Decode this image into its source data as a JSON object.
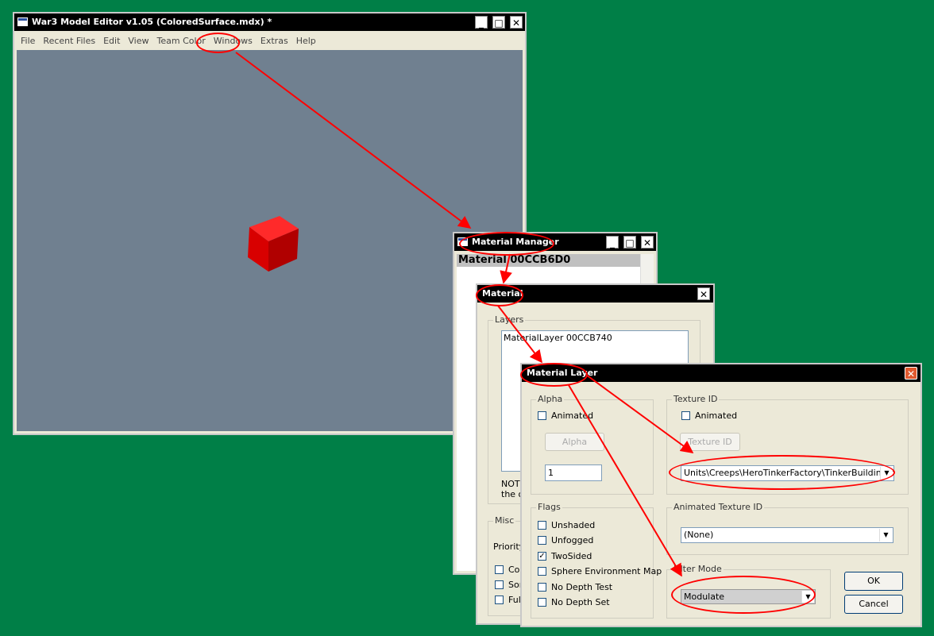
{
  "main_window": {
    "title": "War3 Model Editor v1.05 (ColoredSurface.mdx) *",
    "menu": [
      "File",
      "Recent Files",
      "Edit",
      "View",
      "Team Color",
      "Windows",
      "Extras",
      "Help"
    ]
  },
  "material_manager": {
    "title": "Material Manager",
    "selected_item": "Material 00CCB6D0"
  },
  "material": {
    "title": "Material",
    "layers_label": "Layers",
    "layer_item": "MaterialLayer 00CCB740",
    "note_line1": "NOTE",
    "note_line2": "the o",
    "misc_label": "Misc",
    "priority_label": "Priority",
    "misc_checks": [
      "Con",
      "Sor",
      "Full"
    ]
  },
  "material_layer": {
    "title": "Material Layer",
    "alpha_group": "Alpha",
    "alpha_animated": "Animated",
    "alpha_button": "Alpha",
    "alpha_value": "1",
    "texture_group": "Texture ID",
    "texture_animated": "Animated",
    "texture_button": "Texture ID",
    "texture_value": "Units\\Creeps\\HeroTinkerFactory\\TinkerBuilding.blp",
    "flags_group": "Flags",
    "flags": [
      {
        "label": "Unshaded",
        "checked": false
      },
      {
        "label": "Unfogged",
        "checked": false
      },
      {
        "label": "TwoSided",
        "checked": true
      },
      {
        "label": "Sphere Environment Map",
        "checked": false
      },
      {
        "label": "No Depth Test",
        "checked": false
      },
      {
        "label": "No Depth Set",
        "checked": false
      }
    ],
    "anim_texture_group": "Animated Texture ID",
    "anim_texture_value": "(None)",
    "filter_group": "Filter Mode",
    "filter_value": "Modulate",
    "ok_label": "OK",
    "cancel_label": "Cancel"
  },
  "colors": {
    "desktop": "#007f47",
    "viewport": "#708090",
    "annotation": "#ff0000",
    "cube": "#e00000"
  }
}
